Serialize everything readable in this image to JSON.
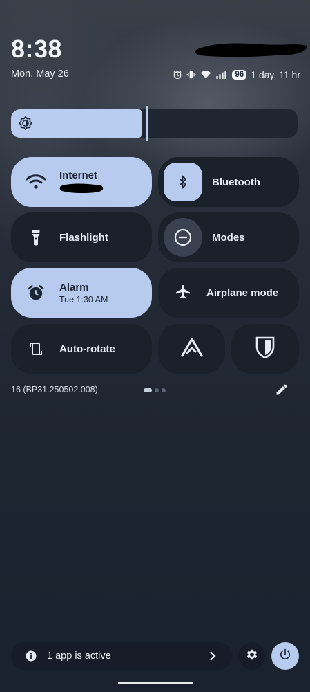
{
  "header": {
    "time": "8:38",
    "date": "Mon, May 26"
  },
  "status_bar": {
    "icons": [
      "alarm-icon",
      "vibrate-icon",
      "wifi-icon",
      "signal-icon"
    ],
    "battery_level": "96",
    "battery_estimate": "1 day, 11 hr"
  },
  "brightness": {
    "level": 0.47,
    "icon": "brightness-icon"
  },
  "tiles": {
    "internet": {
      "label": "Internet",
      "icon": "wifi-icon",
      "active": true
    },
    "bluetooth": {
      "label": "Bluetooth",
      "icon": "bluetooth-icon",
      "active": false
    },
    "flashlight": {
      "label": "Flashlight",
      "icon": "flashlight-icon",
      "active": false
    },
    "modes": {
      "label": "Modes",
      "icon": "do-not-disturb-icon",
      "active": false
    },
    "alarm": {
      "label": "Alarm",
      "sublabel": "Tue 1:30 AM",
      "icon": "alarm-icon",
      "active": true
    },
    "airplane": {
      "label": "Airplane mode",
      "icon": "airplane-icon",
      "active": false
    },
    "autorotate": {
      "label": "Auto-rotate",
      "icon": "rotate-icon",
      "active": false
    },
    "app_tile_1": {
      "icon": "arrow-logo-icon"
    },
    "app_tile_2": {
      "icon": "shield-icon"
    }
  },
  "footer": {
    "build_number": "16 (BP31.250502.008)",
    "page_indicator": {
      "pages": 3,
      "current": 1
    },
    "edit_icon": "pencil-icon"
  },
  "bottom_bar": {
    "active_apps_text": "1 app is active",
    "info_icon": "info-icon",
    "chevron_icon": "chevron-right-icon",
    "settings_icon": "gear-icon",
    "power_icon": "power-icon"
  },
  "colors": {
    "accent": "#b7cbef",
    "tile_inactive": "#1a212b",
    "background": "#222935"
  }
}
